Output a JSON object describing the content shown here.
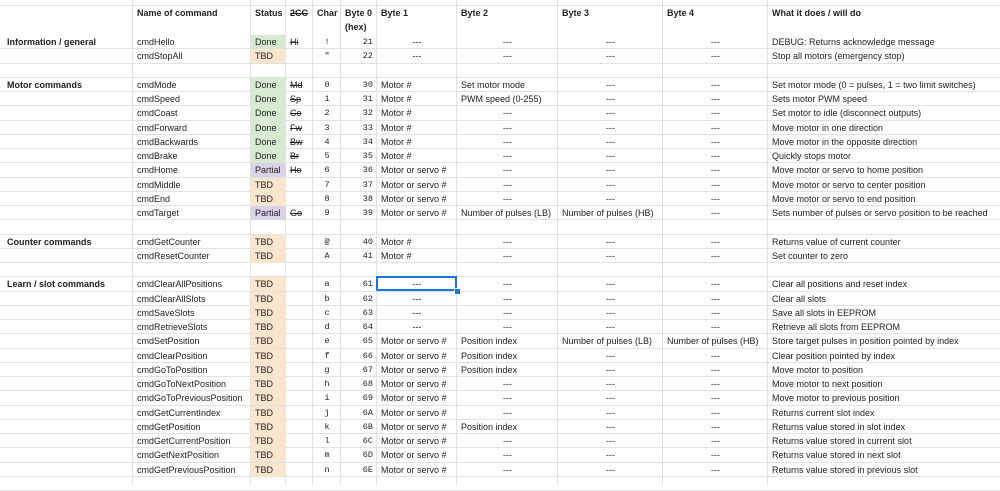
{
  "headers": {
    "name": "Name of command",
    "status": "Status",
    "twocc": "2CC",
    "char": "Char",
    "byte0": "Byte 0",
    "hex": "(hex)",
    "byte1": "Byte 1",
    "byte2": "Byte 2",
    "byte3": "Byte 3",
    "byte4": "Byte 4",
    "what": "What it does / will do"
  },
  "rows": [
    {
      "group": "Information / general",
      "name": "cmdHello",
      "status": "Done",
      "twocc": "Hi",
      "char": "!",
      "byte0": "21",
      "b1": "---",
      "b2": "---",
      "b3": "---",
      "b4": "---",
      "what": "DEBUG: Returns acknowledge message"
    },
    {
      "group": "",
      "name": "cmdStopAll",
      "status": "TBD",
      "twocc": "",
      "char": "\"",
      "byte0": "22",
      "b1": "---",
      "b2": "---",
      "b3": "---",
      "b4": "---",
      "what": "Stop all motors (emergency stop)"
    },
    {
      "spacer": true
    },
    {
      "group": "Motor commands",
      "name": "cmdMode",
      "status": "Done",
      "twocc": "Md",
      "char": "0",
      "byte0": "30",
      "b1": "Motor #",
      "b2": "Set motor mode",
      "b3": "---",
      "b4": "---",
      "what": "Set motor mode (0 = pulses, 1 = two limit switches)"
    },
    {
      "group": "",
      "name": "cmdSpeed",
      "status": "Done",
      "twocc": "Sp",
      "char": "1",
      "byte0": "31",
      "b1": "Motor #",
      "b2": "PWM speed (0-255)",
      "b3": "---",
      "b4": "---",
      "what": "Sets motor PWM speed"
    },
    {
      "group": "",
      "name": "cmdCoast",
      "status": "Done",
      "twocc": "Co",
      "char": "2",
      "byte0": "32",
      "b1": "Motor #",
      "b2": "---",
      "b3": "---",
      "b4": "---",
      "what": "Set motor to idle (disconnect outputs)"
    },
    {
      "group": "",
      "name": "cmdForward",
      "status": "Done",
      "twocc": "Fw",
      "char": "3",
      "byte0": "33",
      "b1": "Motor #",
      "b2": "---",
      "b3": "---",
      "b4": "---",
      "what": "Move motor in one direction"
    },
    {
      "group": "",
      "name": "cmdBackwards",
      "status": "Done",
      "twocc": "Bw",
      "char": "4",
      "byte0": "34",
      "b1": "Motor #",
      "b2": "---",
      "b3": "---",
      "b4": "---",
      "what": "Move motor in the opposite direction"
    },
    {
      "group": "",
      "name": "cmdBrake",
      "status": "Done",
      "twocc": "Br",
      "char": "5",
      "byte0": "35",
      "b1": "Motor #",
      "b2": "---",
      "b3": "---",
      "b4": "---",
      "what": "Quickly stops motor"
    },
    {
      "group": "",
      "name": "cmdHome",
      "status": "Partial",
      "twocc": "Ho",
      "char": "6",
      "byte0": "36",
      "b1": "Motor or servo #",
      "b2": "---",
      "b3": "---",
      "b4": "---",
      "what": "Move motor or servo to home position"
    },
    {
      "group": "",
      "name": "cmdMiddle",
      "status": "TBD",
      "twocc": "",
      "char": "7",
      "byte0": "37",
      "b1": "Motor or servo #",
      "b2": "---",
      "b3": "---",
      "b4": "---",
      "what": "Move motor or servo to center position"
    },
    {
      "group": "",
      "name": "cmdEnd",
      "status": "TBD",
      "twocc": "",
      "char": "8",
      "byte0": "38",
      "b1": "Motor or servo #",
      "b2": "---",
      "b3": "---",
      "b4": "---",
      "what": "Move motor or servo to end position"
    },
    {
      "group": "",
      "name": "cmdTarget",
      "status": "Partial",
      "twocc": "Go",
      "char": "9",
      "byte0": "39",
      "b1": "Motor or servo #",
      "b2": "Number of pulses (LB)",
      "b3": "Number of pulses (HB)",
      "b4": "---",
      "what": "Sets number of pulses or servo position to be reached"
    },
    {
      "spacer": true
    },
    {
      "group": "Counter commands",
      "name": "cmdGetCounter",
      "status": "TBD",
      "twocc": "",
      "char": "@",
      "byte0": "40",
      "b1": "Motor #",
      "b2": "---",
      "b3": "---",
      "b4": "---",
      "what": "Returns value of current counter"
    },
    {
      "group": "",
      "name": "cmdResetCounter",
      "status": "TBD",
      "twocc": "",
      "char": "A",
      "byte0": "41",
      "b1": "Motor #",
      "b2": "---",
      "b3": "---",
      "b4": "---",
      "what": "Set counter to zero"
    },
    {
      "spacer": true
    },
    {
      "group": "Learn / slot commands",
      "name": "cmdClearAllPositions",
      "status": "TBD",
      "twocc": "",
      "char": "a",
      "byte0": "61",
      "b1": "---",
      "b2": "---",
      "b3": "---",
      "b4": "---",
      "what": "Clear all positions and reset index"
    },
    {
      "group": "",
      "name": "cmdClearAllSlots",
      "status": "TBD",
      "twocc": "",
      "char": "b",
      "byte0": "62",
      "b1": "---",
      "b2": "---",
      "b3": "---",
      "b4": "---",
      "what": "Clear all slots"
    },
    {
      "group": "",
      "name": "cmdSaveSlots",
      "status": "TBD",
      "twocc": "",
      "char": "c",
      "byte0": "63",
      "b1": "---",
      "b2": "---",
      "b3": "---",
      "b4": "---",
      "what": "Save all slots in EEPROM"
    },
    {
      "group": "",
      "name": "cmdRetrieveSlots",
      "status": "TBD",
      "twocc": "",
      "char": "d",
      "byte0": "64",
      "b1": "---",
      "b2": "---",
      "b3": "---",
      "b4": "---",
      "what": "Retrieve all slots from EEPROM"
    },
    {
      "group": "",
      "name": "cmdSetPosition",
      "status": "TBD",
      "twocc": "",
      "char": "e",
      "byte0": "65",
      "b1": "Motor or servo #",
      "b2": "Position index",
      "b3": "Number of pulses (LB)",
      "b4": "Number of pulses (HB)",
      "what": "Store target pulses in position pointed by index"
    },
    {
      "group": "",
      "name": "cmdClearPosition",
      "status": "TBD",
      "twocc": "",
      "char": "f",
      "byte0": "66",
      "b1": "Motor or servo #",
      "b2": "Position index",
      "b3": "---",
      "b4": "---",
      "what": "Clear position pointed by index"
    },
    {
      "group": "",
      "name": "cmdGoToPosition",
      "status": "TBD",
      "twocc": "",
      "char": "g",
      "byte0": "67",
      "b1": "Motor or servo #",
      "b2": "Position index",
      "b3": "---",
      "b4": "---",
      "what": "Move motor to position"
    },
    {
      "group": "",
      "name": "cmdGoToNextPosition",
      "status": "TBD",
      "twocc": "",
      "char": "h",
      "byte0": "68",
      "b1": "Motor or servo #",
      "b2": "---",
      "b3": "---",
      "b4": "---",
      "what": "Move motor to next position"
    },
    {
      "group": "",
      "name": "cmdGoToPreviousPosition",
      "status": "TBD",
      "twocc": "",
      "char": "i",
      "byte0": "69",
      "b1": "Motor or servo #",
      "b2": "---",
      "b3": "---",
      "b4": "---",
      "what": "Move motor to previous position"
    },
    {
      "group": "",
      "name": "cmdGetCurrentIndex",
      "status": "TBD",
      "twocc": "",
      "char": "j",
      "byte0": "6A",
      "b1": "Motor or servo #",
      "b2": "---",
      "b3": "---",
      "b4": "---",
      "what": "Returns current slot index"
    },
    {
      "group": "",
      "name": "cmdGetPosition",
      "status": "TBD",
      "twocc": "",
      "char": "k",
      "byte0": "6B",
      "b1": "Motor or servo #",
      "b2": "Position index",
      "b3": "---",
      "b4": "---",
      "what": "Returns value stored in slot index"
    },
    {
      "group": "",
      "name": "cmdGetCurrentPosition",
      "status": "TBD",
      "twocc": "",
      "char": "l",
      "byte0": "6C",
      "b1": "Motor or servo #",
      "b2": "---",
      "b3": "---",
      "b4": "---",
      "what": "Returns value stored in current slot"
    },
    {
      "group": "",
      "name": "cmdGetNextPosition",
      "status": "TBD",
      "twocc": "",
      "char": "m",
      "byte0": "6D",
      "b1": "Motor or servo #",
      "b2": "---",
      "b3": "---",
      "b4": "---",
      "what": "Returns value stored in next slot"
    },
    {
      "group": "",
      "name": "cmdGetPreviousPosition",
      "status": "TBD",
      "twocc": "",
      "char": "n",
      "byte0": "6E",
      "b1": "Motor or servo #",
      "b2": "---",
      "b3": "---",
      "b4": "---",
      "what": "Returns value stored in previous slot"
    }
  ],
  "selected_cell": {
    "row": 17,
    "column": "b1"
  },
  "colors": {
    "done": "#d9ead3",
    "tbd": "#fce5cd",
    "partial": "#d9d2e9",
    "selection": "#1a73e8",
    "grid": "#e2e2e2"
  }
}
